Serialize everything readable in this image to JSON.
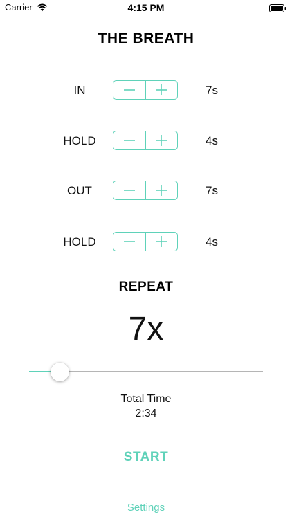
{
  "status_bar": {
    "carrier": "Carrier",
    "time": "4:15 PM",
    "wifi_icon": "wifi-icon",
    "battery_icon": "battery-icon"
  },
  "title": "THE BREATH",
  "rows": [
    {
      "label": "IN",
      "value": "7s"
    },
    {
      "label": "HOLD",
      "value": "4s"
    },
    {
      "label": "OUT",
      "value": "7s"
    },
    {
      "label": "HOLD",
      "value": "4s"
    }
  ],
  "stepper": {
    "minus_icon": "minus-icon",
    "plus_icon": "plus-icon"
  },
  "repeat": {
    "title": "REPEAT",
    "value": "7x",
    "slider_fraction": 0.1
  },
  "total": {
    "label": "Total Time",
    "value": "2:34"
  },
  "start_label": "START",
  "settings_label": "Settings",
  "colors": {
    "accent": "#5fd2b9",
    "text": "#111111",
    "track": "#b5b5b5",
    "background": "#ffffff"
  }
}
